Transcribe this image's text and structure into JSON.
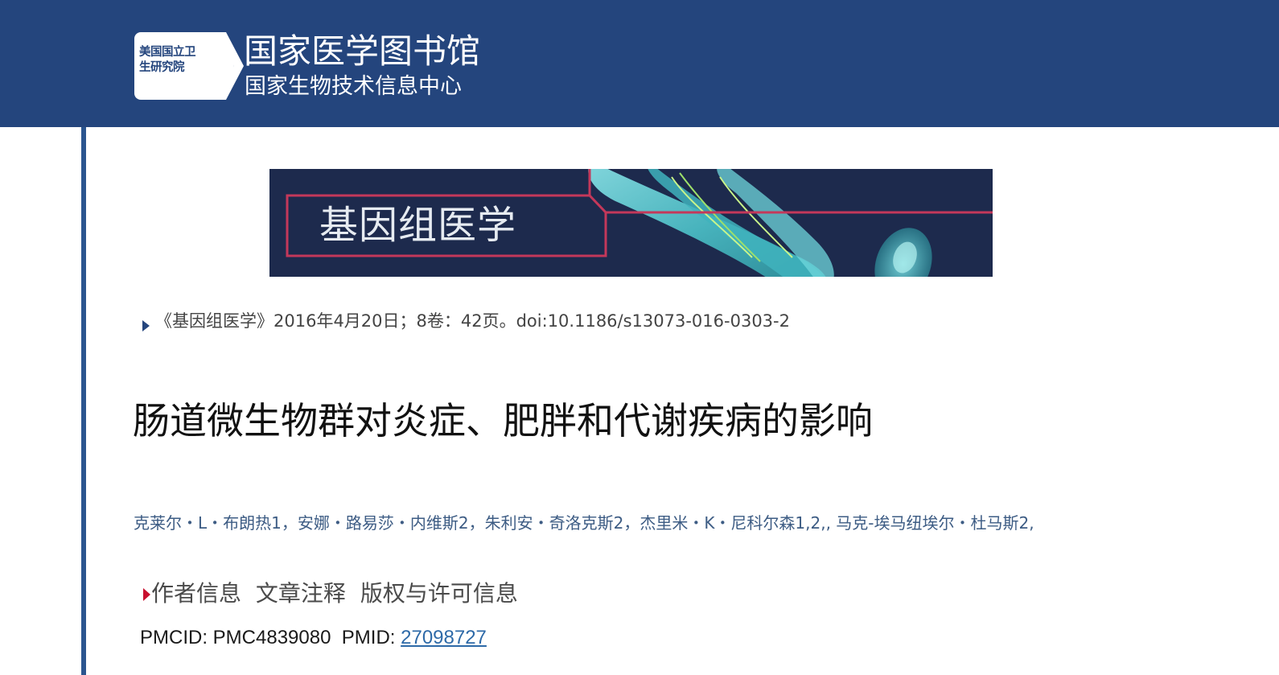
{
  "header": {
    "logo_line1": "美国国立卫",
    "logo_line2": "生研究院",
    "title": "国家医学图书馆",
    "subtitle": "国家生物技术信息中心"
  },
  "banner": {
    "journal_name": "基因组医学",
    "colors": {
      "background": "#1d2a4d",
      "frame": "#c4385a",
      "chromosome": "#59c9cf"
    }
  },
  "citation": {
    "text": "《基因组医学》2016年4月20日；8卷：42页。doi:10.1186/s13073-016-0303-2"
  },
  "article": {
    "title": "肠道微生物群对炎症、肥胖和代谢疾病的影响",
    "authors": "克莱尔・L・布朗热1，安娜・路易莎・内维斯2，朱利安・奇洛克斯2，杰里米・K・尼科尔森1,2,, 马克-埃马纽埃尔・杜马斯2,"
  },
  "info_links": {
    "author_info": "作者信息",
    "article_notes": "文章注释",
    "copyright": "版权与许可信息"
  },
  "ids": {
    "pmcid_label": "PMCID:",
    "pmcid_value": "PMC4839080",
    "pmid_label": "PMID:",
    "pmid_value": "27098727"
  },
  "icons": {
    "logo": "nih-logo-icon",
    "citation_arrow": "triangle-right-icon",
    "info_arrow": "triangle-right-icon"
  },
  "colors": {
    "header_bg": "#24457d",
    "left_rule": "#2b558f",
    "authors": "#3d5c84",
    "link": "#2e6aa8",
    "info_arrow": "#c8102e"
  }
}
